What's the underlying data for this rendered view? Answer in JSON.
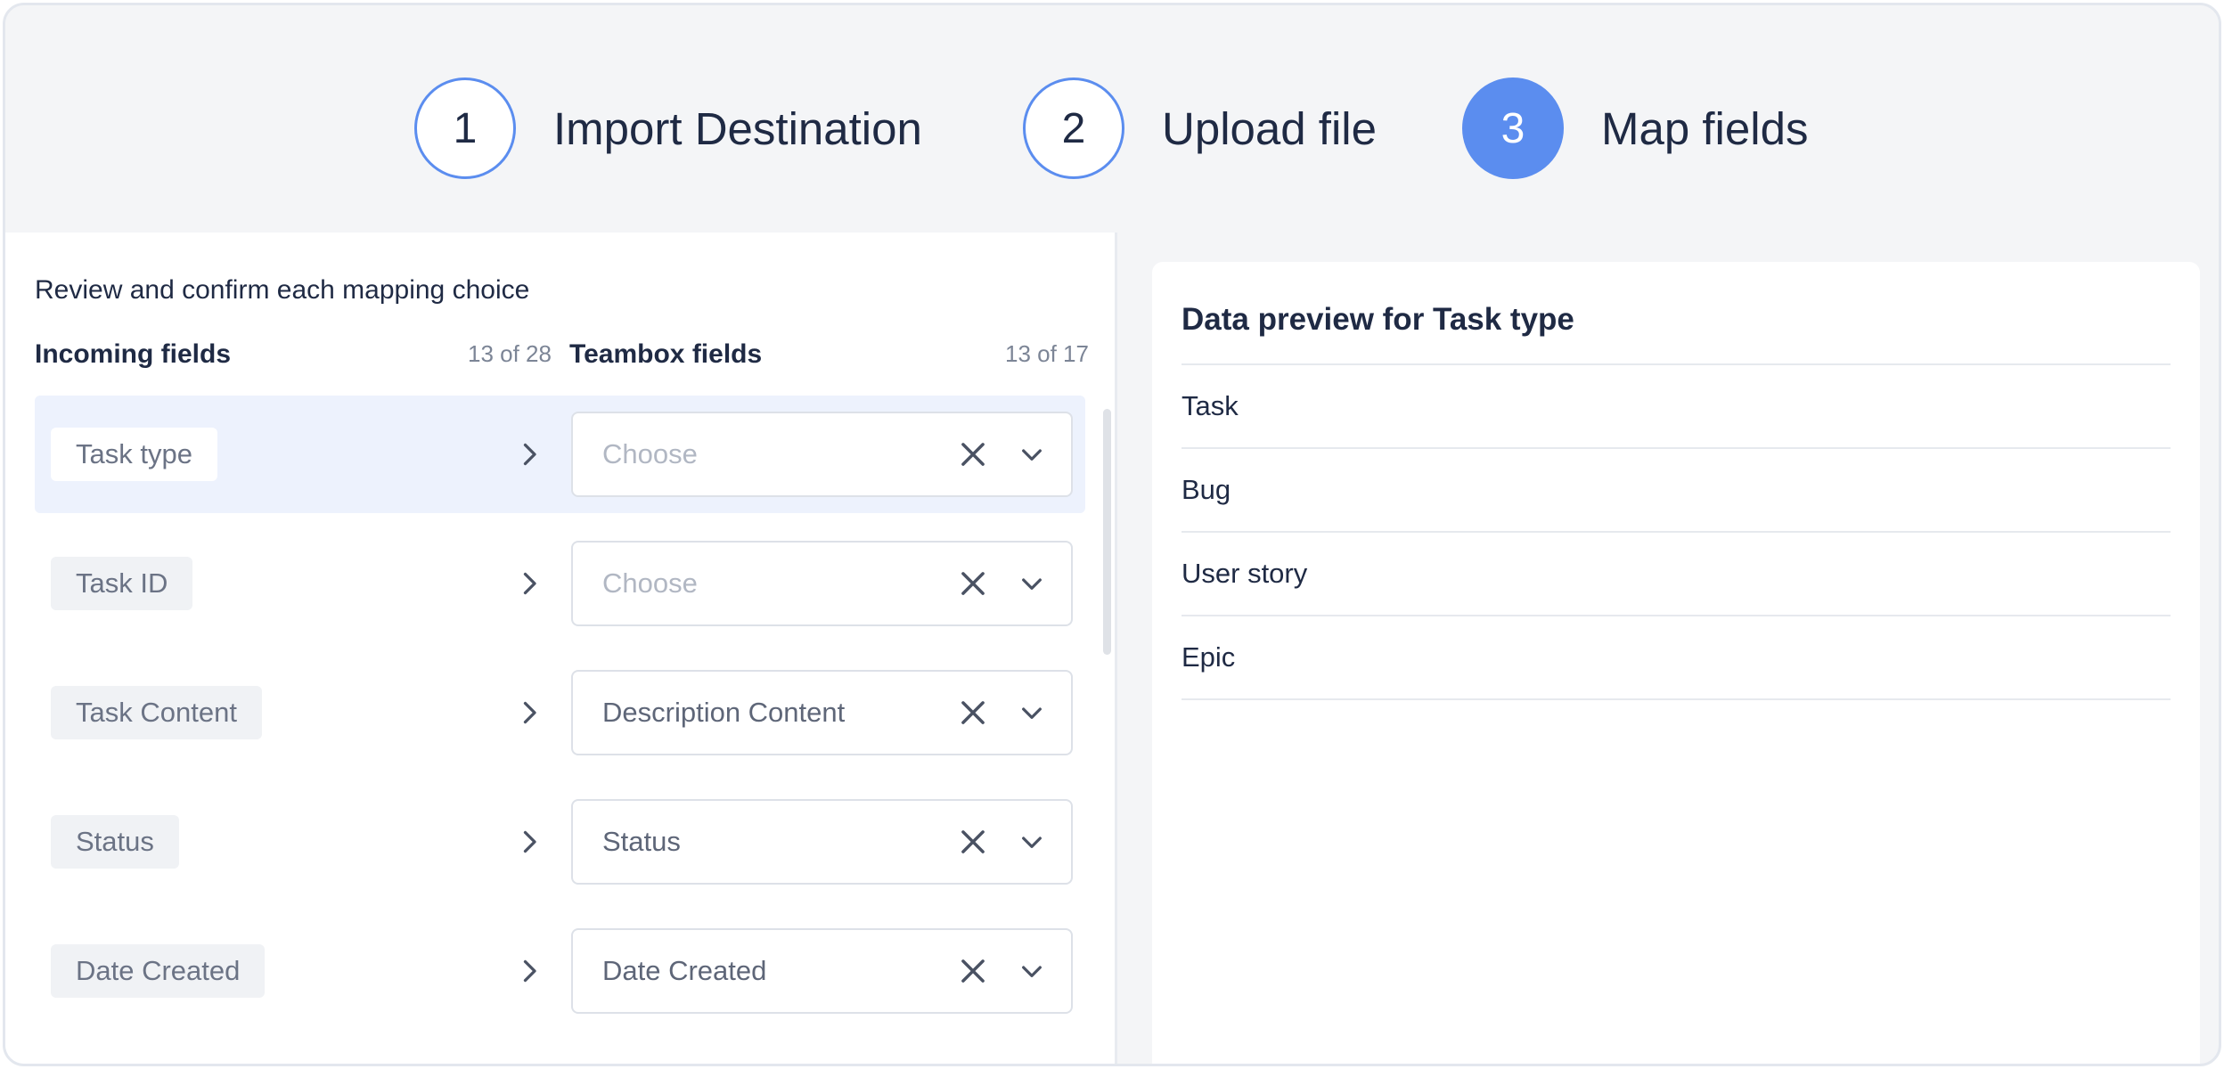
{
  "stepper": {
    "steps": [
      {
        "number": "1",
        "label": "Import Destination"
      },
      {
        "number": "2",
        "label": "Upload file"
      },
      {
        "number": "3",
        "label": "Map fields"
      }
    ]
  },
  "mapping": {
    "instructions": "Review and confirm each mapping choice",
    "incoming_header": "Incoming fields",
    "incoming_count": "13 of 28",
    "teambox_header": "Teambox fields",
    "teambox_count": "13 of 17",
    "select_placeholder": "Choose",
    "rows": [
      {
        "incoming": "Task type",
        "mapped": "",
        "selected": true
      },
      {
        "incoming": "Task ID",
        "mapped": "",
        "selected": false
      },
      {
        "incoming": "Task Content",
        "mapped": "Description Content",
        "selected": false
      },
      {
        "incoming": "Status",
        "mapped": "Status",
        "selected": false
      },
      {
        "incoming": "Date Created",
        "mapped": "Date Created",
        "selected": false
      }
    ]
  },
  "preview": {
    "title": "Data preview for Task type",
    "items": [
      "Task",
      "Bug",
      "User story",
      "Epic"
    ]
  },
  "colors": {
    "accent": "#5b8def",
    "selected_row": "#edf2fd",
    "text": "#1f2a44",
    "muted": "#7c8596"
  },
  "icons": {
    "row_arrow": "chevron-right-icon",
    "select_clear": "close-icon",
    "select_open": "chevron-down-icon"
  }
}
